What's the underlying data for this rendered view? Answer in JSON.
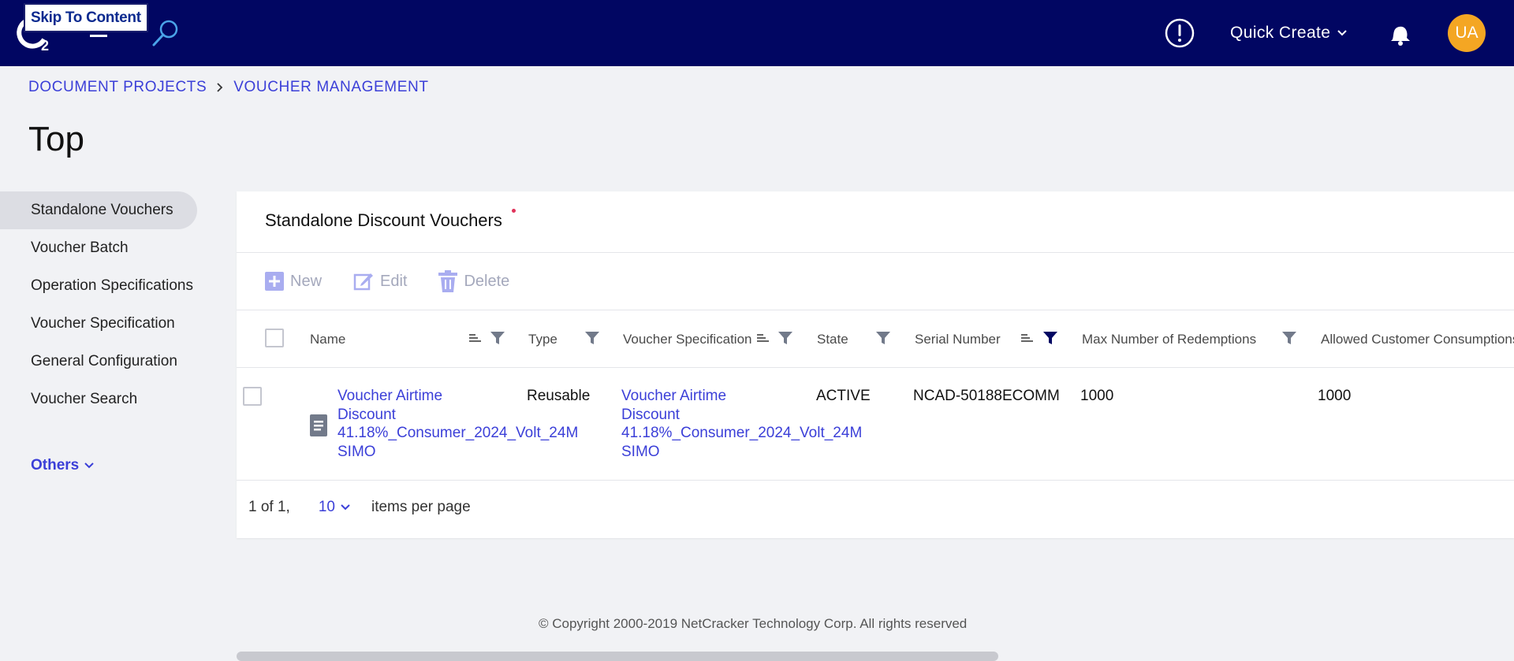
{
  "header": {
    "skip_link": "Skip To Content",
    "logo_subscript": "2",
    "quick_create": "Quick Create",
    "avatar_initials": "UA",
    "colors": {
      "bar": "#010662",
      "avatar": "#f4a623"
    }
  },
  "breadcrumb": [
    "DOCUMENT PROJECTS",
    "VOUCHER MANAGEMENT"
  ],
  "page_title": "Top",
  "sidenav": {
    "items": [
      {
        "label": "Standalone Vouchers",
        "active": true
      },
      {
        "label": "Voucher Batch"
      },
      {
        "label": "Operation Specifications"
      },
      {
        "label": "Voucher Specification"
      },
      {
        "label": "General Configuration"
      },
      {
        "label": "Voucher Search"
      }
    ],
    "others": "Others"
  },
  "card": {
    "title": "Standalone Discount Vouchers",
    "toolbar": {
      "new": "New",
      "edit": "Edit",
      "delete": "Delete"
    },
    "columns": [
      "Name",
      "Type",
      "Voucher Specification",
      "State",
      "Serial Number",
      "Max Number of Redemptions",
      "Allowed Customer Consumptions"
    ],
    "rows": [
      {
        "name": [
          "Voucher Airtime",
          "Discount",
          "41.18%_Consumer_2024_Volt_24M",
          "SIMO"
        ],
        "type": "Reusable",
        "voucher_spec": [
          "Voucher Airtime",
          "Discount",
          "41.18%_Consumer_2024_Volt_24M",
          "SIMO"
        ],
        "state": "ACTIVE",
        "serial_number": "NCAD-50188ECOMM",
        "max_redemptions": "1000",
        "allowed_consumptions": "1000"
      }
    ],
    "pager": {
      "range": "1 of 1,",
      "page_size": "10",
      "suffix": "items per page"
    }
  },
  "footer": "© Copyright 2000-2019 NetCracker Technology Corp. All rights reserved",
  "icons": [
    "logo-icon",
    "hamburger-icon",
    "search-icon",
    "alert-icon",
    "chevron-down-icon",
    "bell-icon",
    "plus-icon",
    "edit-icon",
    "trash-icon",
    "sort-icon",
    "filter-icon",
    "document-icon"
  ]
}
